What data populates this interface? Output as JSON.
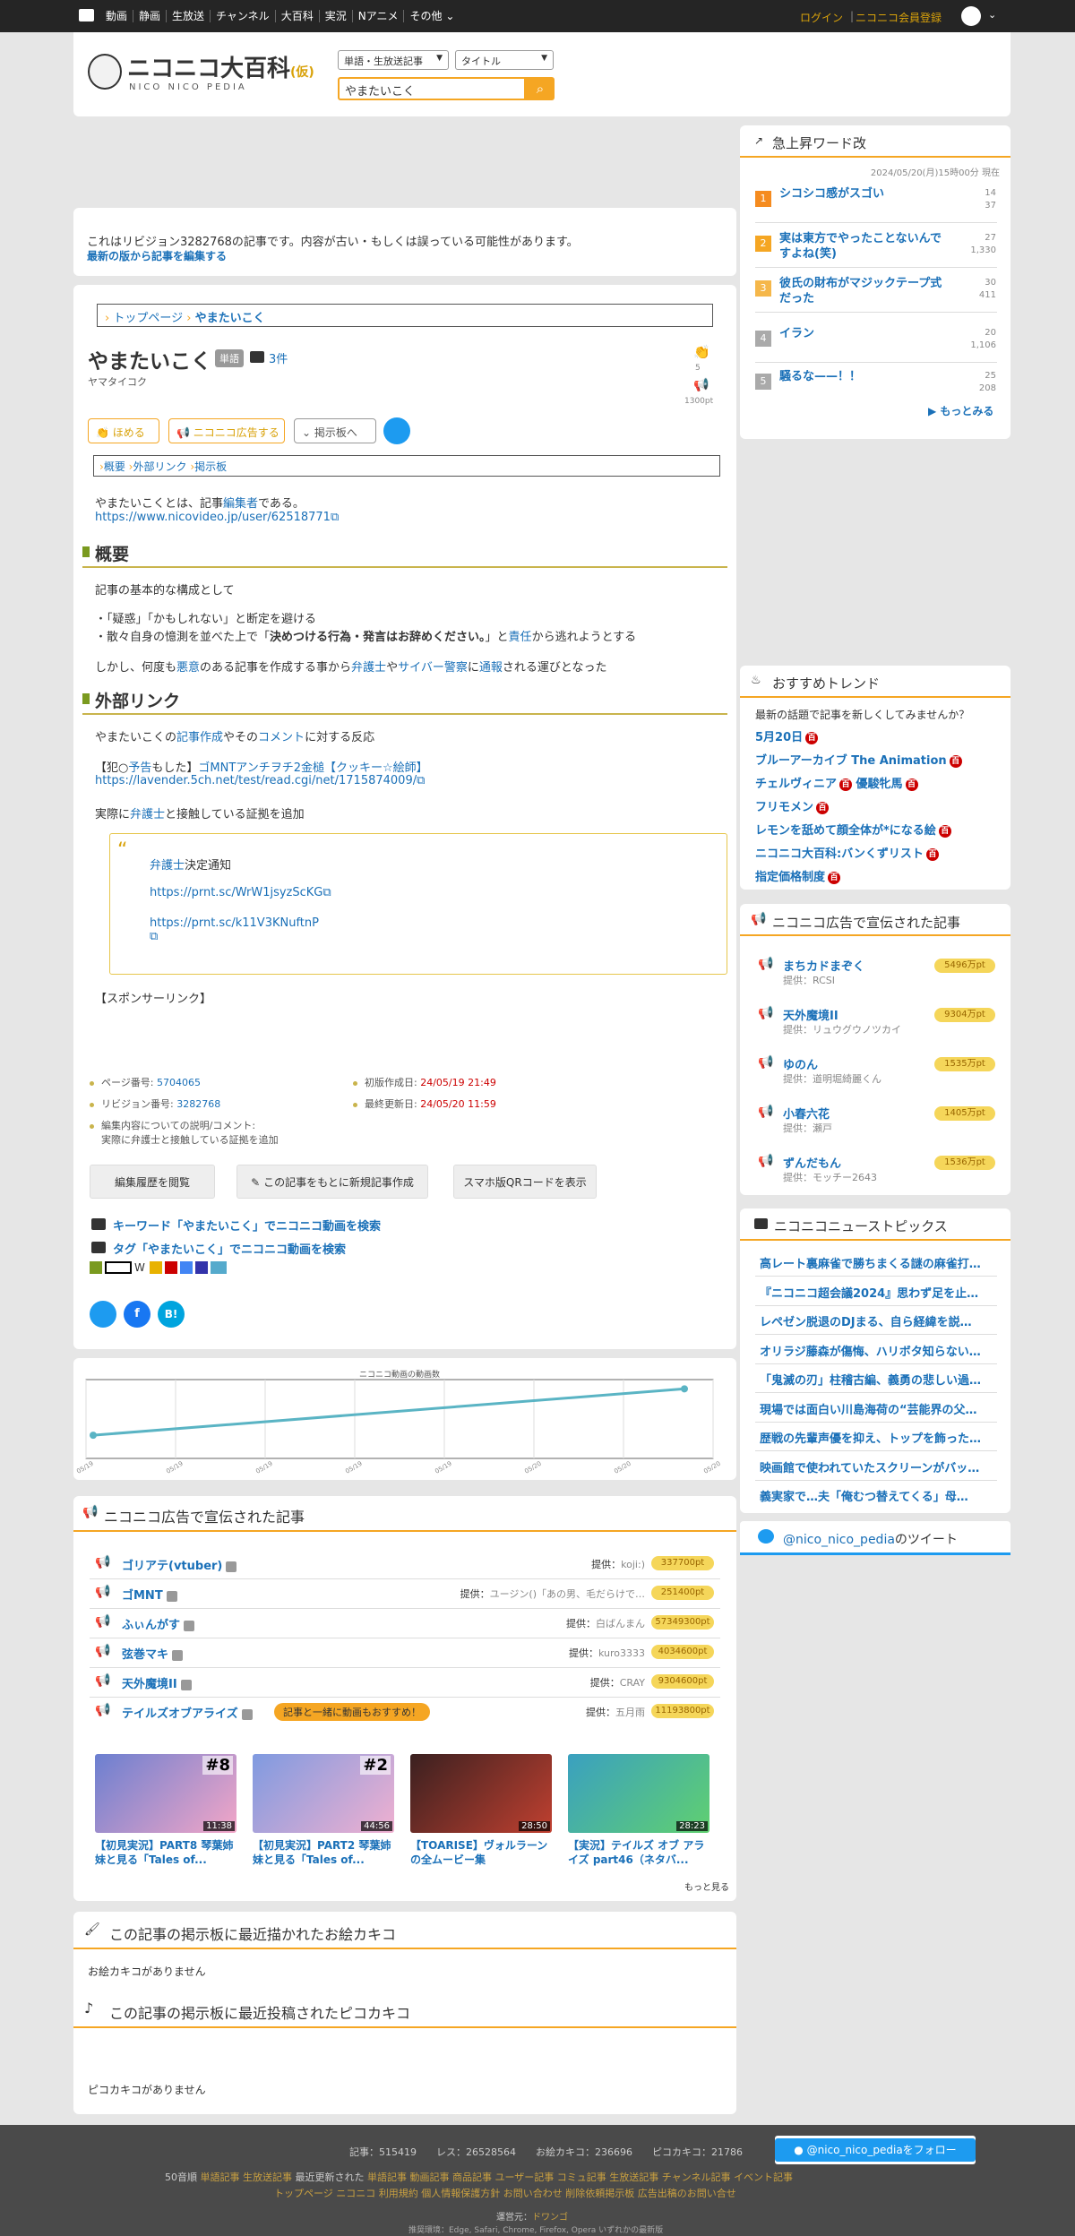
{
  "topbar": {
    "nav": [
      "動画",
      "静画",
      "生放送",
      "チャンネル",
      "大百科",
      "実況",
      "Nアニメ",
      "その他"
    ],
    "login": "ログイン",
    "register": "ニコニコ会員登録"
  },
  "header": {
    "logo": "ニコニコ大百科",
    "logo_badge": "(仮)",
    "logo_sub": "NICO NICO PEDIA",
    "select1": "単語・生放送記事",
    "select2": "タイトル",
    "search_value": "やまたいこく"
  },
  "revision": {
    "notice": "これはリビジョン3282768の記事です。内容が古い・もしくは誤っている可能性があります。",
    "edit_link": "最新の版から記事を編集する"
  },
  "breadcrumb": {
    "top": "トップページ",
    "current": "やまたいこく"
  },
  "article": {
    "title": "やまたいこく",
    "category": "単語",
    "tv_count": "3件",
    "reading": "ヤマタイコク",
    "like_count": "5",
    "ad_points": "1300pt",
    "buttons": {
      "praise": "ほめる",
      "ad": "ニコニコ広告する",
      "board": "掲示板へ"
    },
    "toc": [
      "概要",
      "外部リンク",
      "掲示板"
    ],
    "intro1": "やまたいこくとは、記事",
    "intro1_link": "編集者",
    "intro1_end": "である。",
    "intro_url": "https://www.nicovideo.jp/user/62518771",
    "sec1": "概要",
    "s1_p1": "記事の基本的な構成として",
    "s1_l1": "・「疑惑」「かもしれない」と断定を避ける",
    "s1_l2a": "・散々自身の憶測を並べた上で「",
    "s1_l2b": "決めつける行為・発言はお辞めください。",
    "s1_l2c": "」と",
    "s1_l2d": "責任",
    "s1_l2e": "から逃れようとする",
    "s1_p2a": "しかし、何度も",
    "s1_p2b": "悪意",
    "s1_p2c": "のある記事を作成する事から",
    "s1_p2d": "弁護士",
    "s1_p2e": "や",
    "s1_p2f": "サイバー警察",
    "s1_p2g": "に",
    "s1_p2h": "通報",
    "s1_p2i": "される運びとなった",
    "sec2": "外部リンク",
    "s2_p1a": "やまたいこくの",
    "s2_p1b": "記事作成",
    "s2_p1c": "やその",
    "s2_p1d": "コメント",
    "s2_p1e": "に対する反応",
    "s2_p2a": "【犯○",
    "s2_p2b": "予告",
    "s2_p2c": "もした】",
    "s2_p2d": "ゴMNTアンチヲチ2金槌【クッキー☆絵師】",
    "s2_url1": "https://lavender.5ch.net/test/read.cgi/net/1715874009/",
    "s2_p3a": "実際に",
    "s2_p3b": "弁護士",
    "s2_p3c": "と接触している証拠を追加",
    "quote_l1a": "弁護士",
    "quote_l1b": "決定通知",
    "quote_url1": "https://prnt.sc/WrW1jsyzScKG",
    "quote_url2a": "https://prnt.sc/k11V3KNuftnP",
    "sponsor": "【スポンサーリンク】"
  },
  "meta": {
    "page_no_label": "ページ番号:",
    "page_no": "5704065",
    "created_label": "初版作成日:",
    "created": "24/05/19 21:49",
    "rev_no_label": "リビジョン番号:",
    "rev_no": "3282768",
    "updated_label": "最終更新日:",
    "updated": "24/05/20 11:59",
    "edit_note_label": "編集内容についての説明/コメント:",
    "edit_note": "実際に弁護士と接触している証拠を追加"
  },
  "actions": {
    "history": "編集履歴を閲覧",
    "new_article": "この記事をもとに新規記事作成",
    "qr": "スマホ版QRコードを表示"
  },
  "search_links": {
    "keyword": "キーワード「やまたいこく」でニコニコ動画を検索",
    "tag": "タグ「やまたいこく」でニコニコ動画を検索"
  },
  "chart_data": {
    "type": "line",
    "title": "ニコニコ動画の動画数",
    "xlabel": "",
    "ylabel": "",
    "x": [
      "05/19",
      "05/19",
      "05/19",
      "05/19",
      "05/19",
      "05/20",
      "05/20",
      "05/20"
    ],
    "values": [
      1,
      2
    ],
    "grid": true
  },
  "ads_section": {
    "title": "ニコニコ広告で宣伝された記事",
    "prov_label": "提供：",
    "rows": [
      {
        "name": "ゴリアテ(vtuber)",
        "prov": "koji:)",
        "pts": "337700pt"
      },
      {
        "name": "ゴMNT",
        "prov": "ユージン()「あの男、毛だらけで…",
        "pts": "251400pt"
      },
      {
        "name": "ふぃんがす",
        "prov": "白ばんまん",
        "pts": "57349300pt"
      },
      {
        "name": "弦巻マキ",
        "prov": "kuro3333",
        "pts": "4034600pt"
      },
      {
        "name": "天外魔境II",
        "prov": "CRAY",
        "pts": "9304600pt"
      },
      {
        "name": "テイルズオブアライズ",
        "prov": "五月雨",
        "pts": "11193800pt",
        "promo": "記事と一緒に動画もおすすめ！"
      }
    ],
    "videos": [
      {
        "title": "【初見実況】PART8 琴葉姉妹と見る「Tales of...",
        "dur": "11:38",
        "num": "#8"
      },
      {
        "title": "【初見実況】PART2 琴葉姉妹と見る「Tales of...",
        "dur": "44:56",
        "num": "#2"
      },
      {
        "title": "【TOARISE】ヴォルラーンの全ムービー集",
        "dur": "28:50",
        "num": ""
      },
      {
        "title": "【実況】テイルズ オブ アライズ part46（ネタバ...",
        "dur": "28:23",
        "num": ""
      }
    ],
    "more": "もっと見る"
  },
  "oekaki": {
    "title": "この記事の掲示板に最近描かれたお絵カキコ",
    "empty": "お絵カキコがありません"
  },
  "picoaki": {
    "title": "この記事の掲示板に最近投稿されたピコカキコ",
    "empty": "ピコカキコがありません"
  },
  "sidebar": {
    "rising_title": "急上昇ワード改",
    "rising_time": "2024/05/20(月)15時00分 現在",
    "rising": [
      {
        "n": "1",
        "t": "シコシコ感がスゴい",
        "a": "14",
        "b": "37"
      },
      {
        "n": "2",
        "t": "実は東方でやったことないんですよね(笑)",
        "a": "27",
        "b": "1,330"
      },
      {
        "n": "3",
        "t": "彼氏の財布がマジックテープ式だった",
        "a": "30",
        "b": "411"
      },
      {
        "n": "4",
        "t": "イラン",
        "a": "20",
        "b": "1,106"
      },
      {
        "n": "5",
        "t": "騒るな——！！",
        "a": "25",
        "b": "208"
      }
    ],
    "rising_more": "もっとみる",
    "trend_title": "おすすめトレンド",
    "trend_lead": "最新の話題で記事を新しくしてみませんか？",
    "trends": [
      "5月20日",
      "ブルーアーカイブ The Animation",
      "チェルヴィニア",
      "優駿牝馬",
      "フリモメン",
      "レモンを舐めて顔全体が*になる絵",
      "ニコニコ大百科:バンくずリスト",
      "指定価格制度"
    ],
    "ad_title": "ニコニコ広告で宣伝された記事",
    "prov_label": "提供：",
    "ads": [
      {
        "t": "まちカドまぞく",
        "p": "RCSI",
        "pts": "5496万pt"
      },
      {
        "t": "天外魔境II",
        "p": "リュウグウノツカイ",
        "pts": "9304万pt"
      },
      {
        "t": "ゆのん",
        "p": "道明堀綺麗くん",
        "pts": "1535万pt"
      },
      {
        "t": "小春六花",
        "p": "瀬戸",
        "pts": "1405万pt"
      },
      {
        "t": "ずんだもん",
        "p": "モッチー2643",
        "pts": "1536万pt"
      }
    ],
    "news_title": "ニコニコニューストピックス",
    "news": [
      "高レート裏麻雀で勝ちまくる謎の麻雀打…",
      "『ニコニコ超会議2024』思わず足を止…",
      "レペゼン脱退のDJまる、自ら経緯を説…",
      "オリラジ藤森が傷悔、ハリボタ知らない…",
      "「鬼滅の刃」柱稽古編、義勇の悲しい過…",
      "現場では面白い川島海荷の“芸能界の父…",
      "歴戦の先輩声優を抑え、トップを飾った…",
      "映画館で使われていたスクリーンがバッ…",
      "義実家で…夫「俺むつ替えてくる」母…"
    ],
    "twitter_handle": "@nico_nico_pedia",
    "twitter_suffix": "のツイート"
  },
  "footer": {
    "stats": "記事：515419　　レス：26528564　　お絵カキコ：236696　　ピコカキコ：21786",
    "follow": "@nico_nico_pediaをフォロー",
    "row1_label": "50音順",
    "row1_links": [
      "単語記事",
      "生放送記事"
    ],
    "row1_mid": "最近更新された",
    "row1_links2": [
      "単語記事",
      "動画記事",
      "商品記事",
      "ユーザー記事",
      "コミュ記事",
      "生放送記事",
      "チャンネル記事",
      "イベント記事"
    ],
    "row2_links": [
      "トップページ",
      "ニコニコ",
      "利用規約",
      "個人情報保護方針",
      "お問い合わせ",
      "削除依頼掲示板",
      "広告出稿のお問い合せ"
    ],
    "operator_label": "運営元：",
    "operator": "ドワンゴ",
    "env": "推奨環境：Edge, Safari, Chrome, Firefox, Opera いずれかの最新版"
  }
}
